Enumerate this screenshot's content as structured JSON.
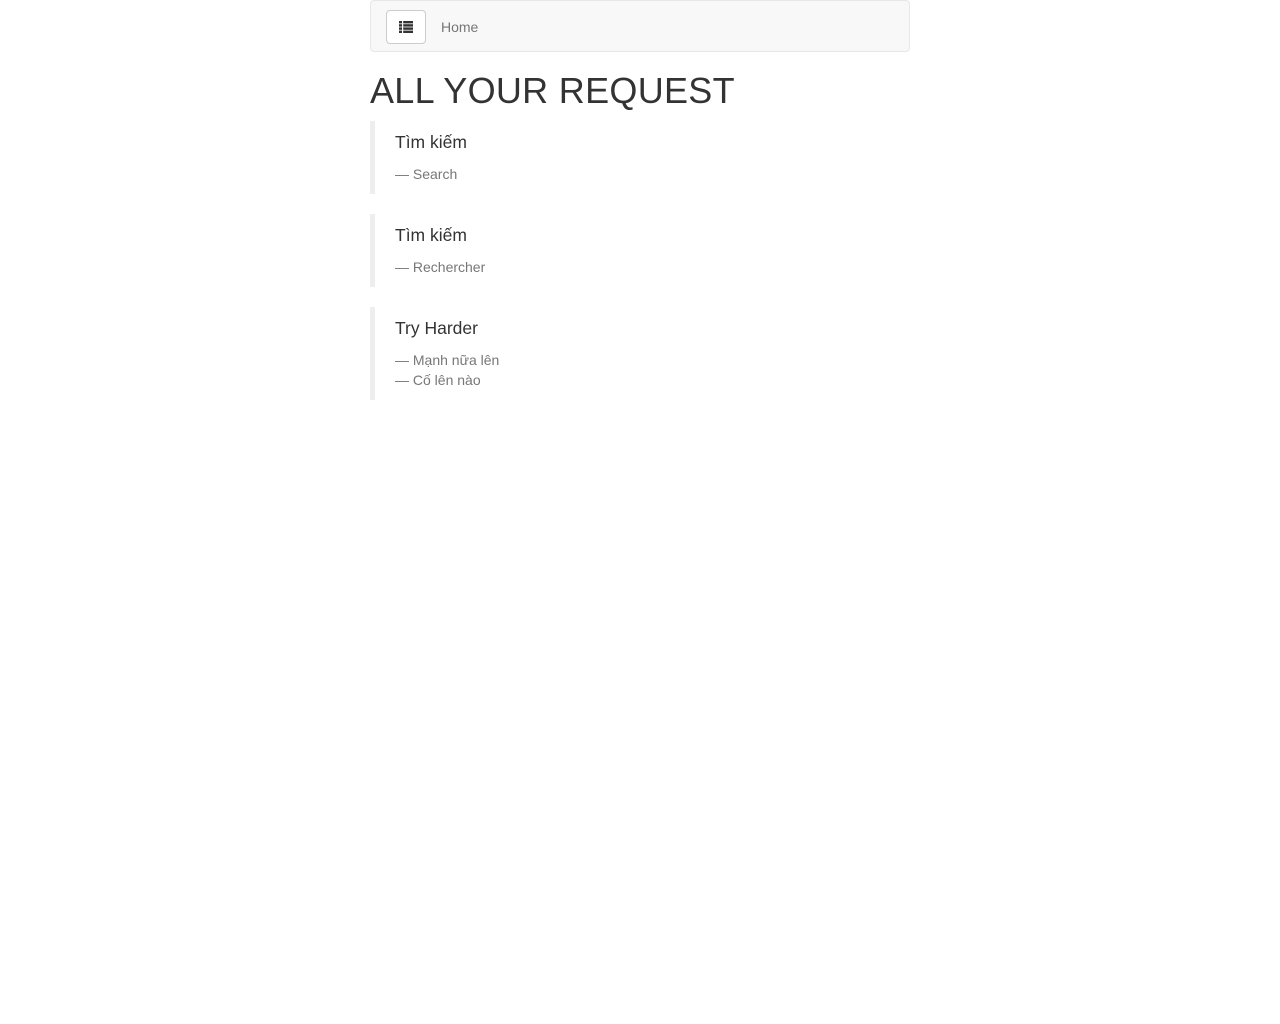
{
  "navbar": {
    "toggle_icon": "list-icon",
    "home_label": "Home"
  },
  "page": {
    "title": "ALL YOUR REQUEST"
  },
  "quotes": [
    {
      "title": "Tìm kiếm",
      "sources": [
        "Search"
      ]
    },
    {
      "title": "Tìm kiếm",
      "sources": [
        "Rechercher"
      ]
    },
    {
      "title": "Try Harder",
      "sources": [
        "Mạnh nữa lên",
        "Cố lên nào"
      ]
    }
  ]
}
